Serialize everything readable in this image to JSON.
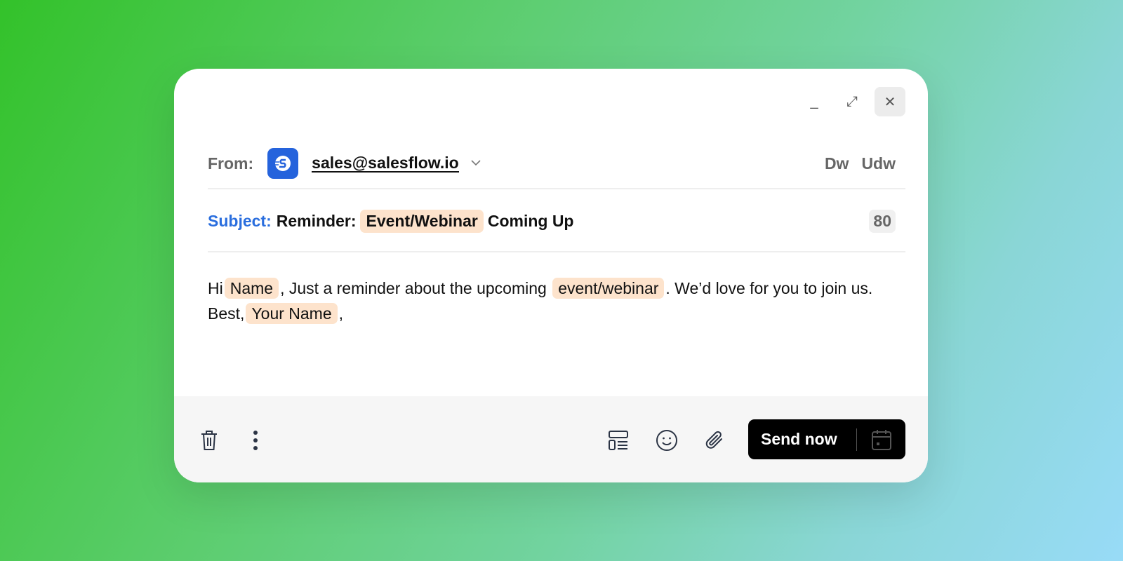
{
  "window": {
    "minimize": "_",
    "expand": "⤢",
    "close": "✕"
  },
  "from": {
    "label": "From:",
    "email": "sales@salesflow.io",
    "actions": [
      "Dw",
      "Udw"
    ]
  },
  "subject": {
    "label": "Subject:",
    "prefix": "Reminder:",
    "token": "Event/Webinar",
    "suffix": "Coming Up",
    "char_count": "80"
  },
  "body": {
    "p1": "Hi",
    "t1": "Name",
    "p2": ", Just a reminder about the upcoming",
    "t2": "event/webinar",
    "p3": ". We’d love for you to join us. Best,",
    "t3": "Your Name",
    "p4": ","
  },
  "footer": {
    "send_label": "Send now"
  },
  "colors": {
    "accent": "#2a6ede",
    "token_bg": "#fde3cc",
    "send_bg": "#000000"
  }
}
